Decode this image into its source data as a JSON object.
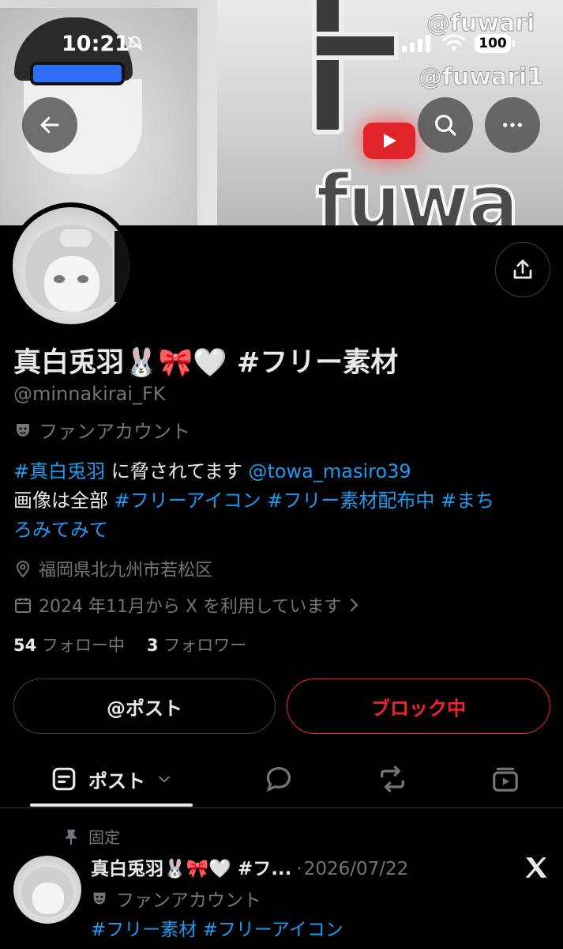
{
  "status_bar": {
    "time": "10:21",
    "battery": "100"
  },
  "banner": {
    "word": "fuwa",
    "watermark_1": "@fuwari",
    "watermark_2": "@fuwari1"
  },
  "nav": {
    "back_icon": "back-arrow-icon",
    "search_icon": "search-icon",
    "more_icon": "more-icon"
  },
  "profile": {
    "display_name": "真白兎羽🐰🎀🤍 #フリー素材",
    "handle": "@minnakirai_FK",
    "label": "ファンアカウント",
    "bio": {
      "line1_tag1": "#真白兎羽",
      "line1_text": " に脅されてます ",
      "line1_mention": "@towa_masiro39",
      "line2_text": "画像は全部 ",
      "line2_tag1": "#フリーアイコン",
      "line2_tag2": "#フリー素材配布中",
      "line2_tag3": "#まち",
      "line3_tag3": "ろみてみて"
    },
    "location": "福岡県北九州市若松区",
    "joined": "2024 年11月から X を利用しています",
    "following_count": "54",
    "following_label": "フォロー中",
    "followers_count": "3",
    "followers_label": "フォロワー"
  },
  "actions": {
    "post_label": "@ポスト",
    "block_label": "ブロック中",
    "block_color": "#f4212e"
  },
  "tabs": {
    "posts_label": "ポスト"
  },
  "pinned_post": {
    "pinned_label": "固定",
    "name": "真白兎羽🐰🎀🤍 #フ...",
    "separator": "·",
    "date": "2026/07/22",
    "label": "ファンアカウント",
    "text": "#フリー素材 #フリーアイコン"
  },
  "colors": {
    "accent": "#1d9bf0",
    "muted": "#71767b",
    "text": "#e7e9ea",
    "background": "#000000"
  }
}
